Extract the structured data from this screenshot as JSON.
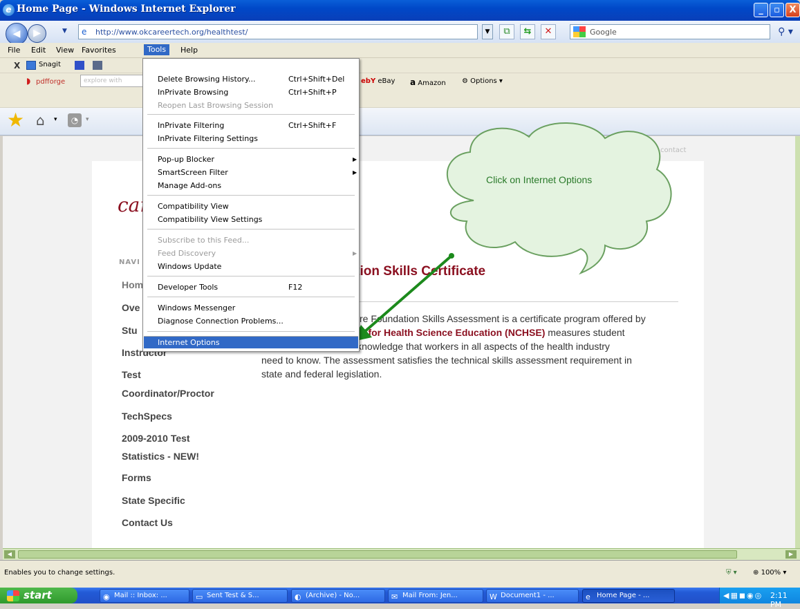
{
  "window": {
    "title": "Home Page - Windows Internet Explorer",
    "minimize": "_",
    "maximize": "▫",
    "close": "X"
  },
  "address": {
    "url": "http://www.okcareertech.org/healthtest/",
    "search_placeholder": "Google"
  },
  "menubar": [
    "File",
    "Edit",
    "View",
    "Favorites",
    "Tools",
    "Help"
  ],
  "toolbar1": {
    "snagit": "Snagit"
  },
  "toolbar2": {
    "pdfforge": "pdfforge",
    "explore": "explore with",
    "ebay": "eBay",
    "amazon": "Amazon",
    "options": "Options ▾"
  },
  "tools_menu": {
    "items": [
      {
        "label": "Delete Browsing History...",
        "shortcut": "Ctrl+Shift+Del"
      },
      {
        "label": "InPrivate Browsing",
        "shortcut": "Ctrl+Shift+P"
      },
      {
        "label": "Reopen Last Browsing Session",
        "shortcut": ""
      },
      {
        "label": "InPrivate Filtering",
        "shortcut": "Ctrl+Shift+F"
      },
      {
        "label": "InPrivate Filtering Settings",
        "shortcut": ""
      },
      {
        "label": "Pop-up Blocker",
        "shortcut": ""
      },
      {
        "label": "SmartScreen Filter",
        "shortcut": ""
      },
      {
        "label": "Manage Add-ons",
        "shortcut": ""
      },
      {
        "label": "Compatibility View",
        "shortcut": ""
      },
      {
        "label": "Compatibility View Settings",
        "shortcut": ""
      },
      {
        "label": "Subscribe to this Feed...",
        "shortcut": ""
      },
      {
        "label": "Feed Discovery",
        "shortcut": ""
      },
      {
        "label": "Windows Update",
        "shortcut": ""
      },
      {
        "label": "Developer Tools",
        "shortcut": "F12"
      },
      {
        "label": "Windows Messenger",
        "shortcut": ""
      },
      {
        "label": "Diagnose Connection Problems...",
        "shortcut": ""
      },
      {
        "label": "Internet Options",
        "shortcut": ""
      }
    ]
  },
  "page": {
    "logo": "car",
    "contact_link": "contact",
    "nav_heading": "NAVI",
    "nav": [
      "Hom",
      "Ove",
      "Stu",
      "Instructor",
      "Test",
      "Coordinator/Proctor",
      "TechSpecs",
      "2009-2010 Test",
      "Statistics - NEW!",
      "Forms",
      "State Specific",
      "Contact Us"
    ],
    "heading": "lthcare Foundation Skills Certificate",
    "para_1": "re Foundation Skills Assessment is a certificate program offered by",
    "para_2_bold": "n for Health Science Education (NCHSE)",
    "para_2_rest": " measures student",
    "para_3": "s and knowledge that workers in all aspects of the health industry",
    "para_4": "need to know.  The assessment satisfies the technical skills assessment requirement in",
    "para_5": "state and federal legislation."
  },
  "callout": {
    "text": "Click on Internet Options"
  },
  "status": {
    "text": "Enables you to change settings.",
    "zoom": "100%"
  },
  "taskbar": {
    "start": "start",
    "tasks": [
      "Mail :: Inbox: ...",
      "Sent Test & S...",
      "(Archive) - No...",
      "Mail From: Jen...",
      "Document1 - ...",
      "Home Page - ..."
    ],
    "clock": "2:11 PM"
  }
}
